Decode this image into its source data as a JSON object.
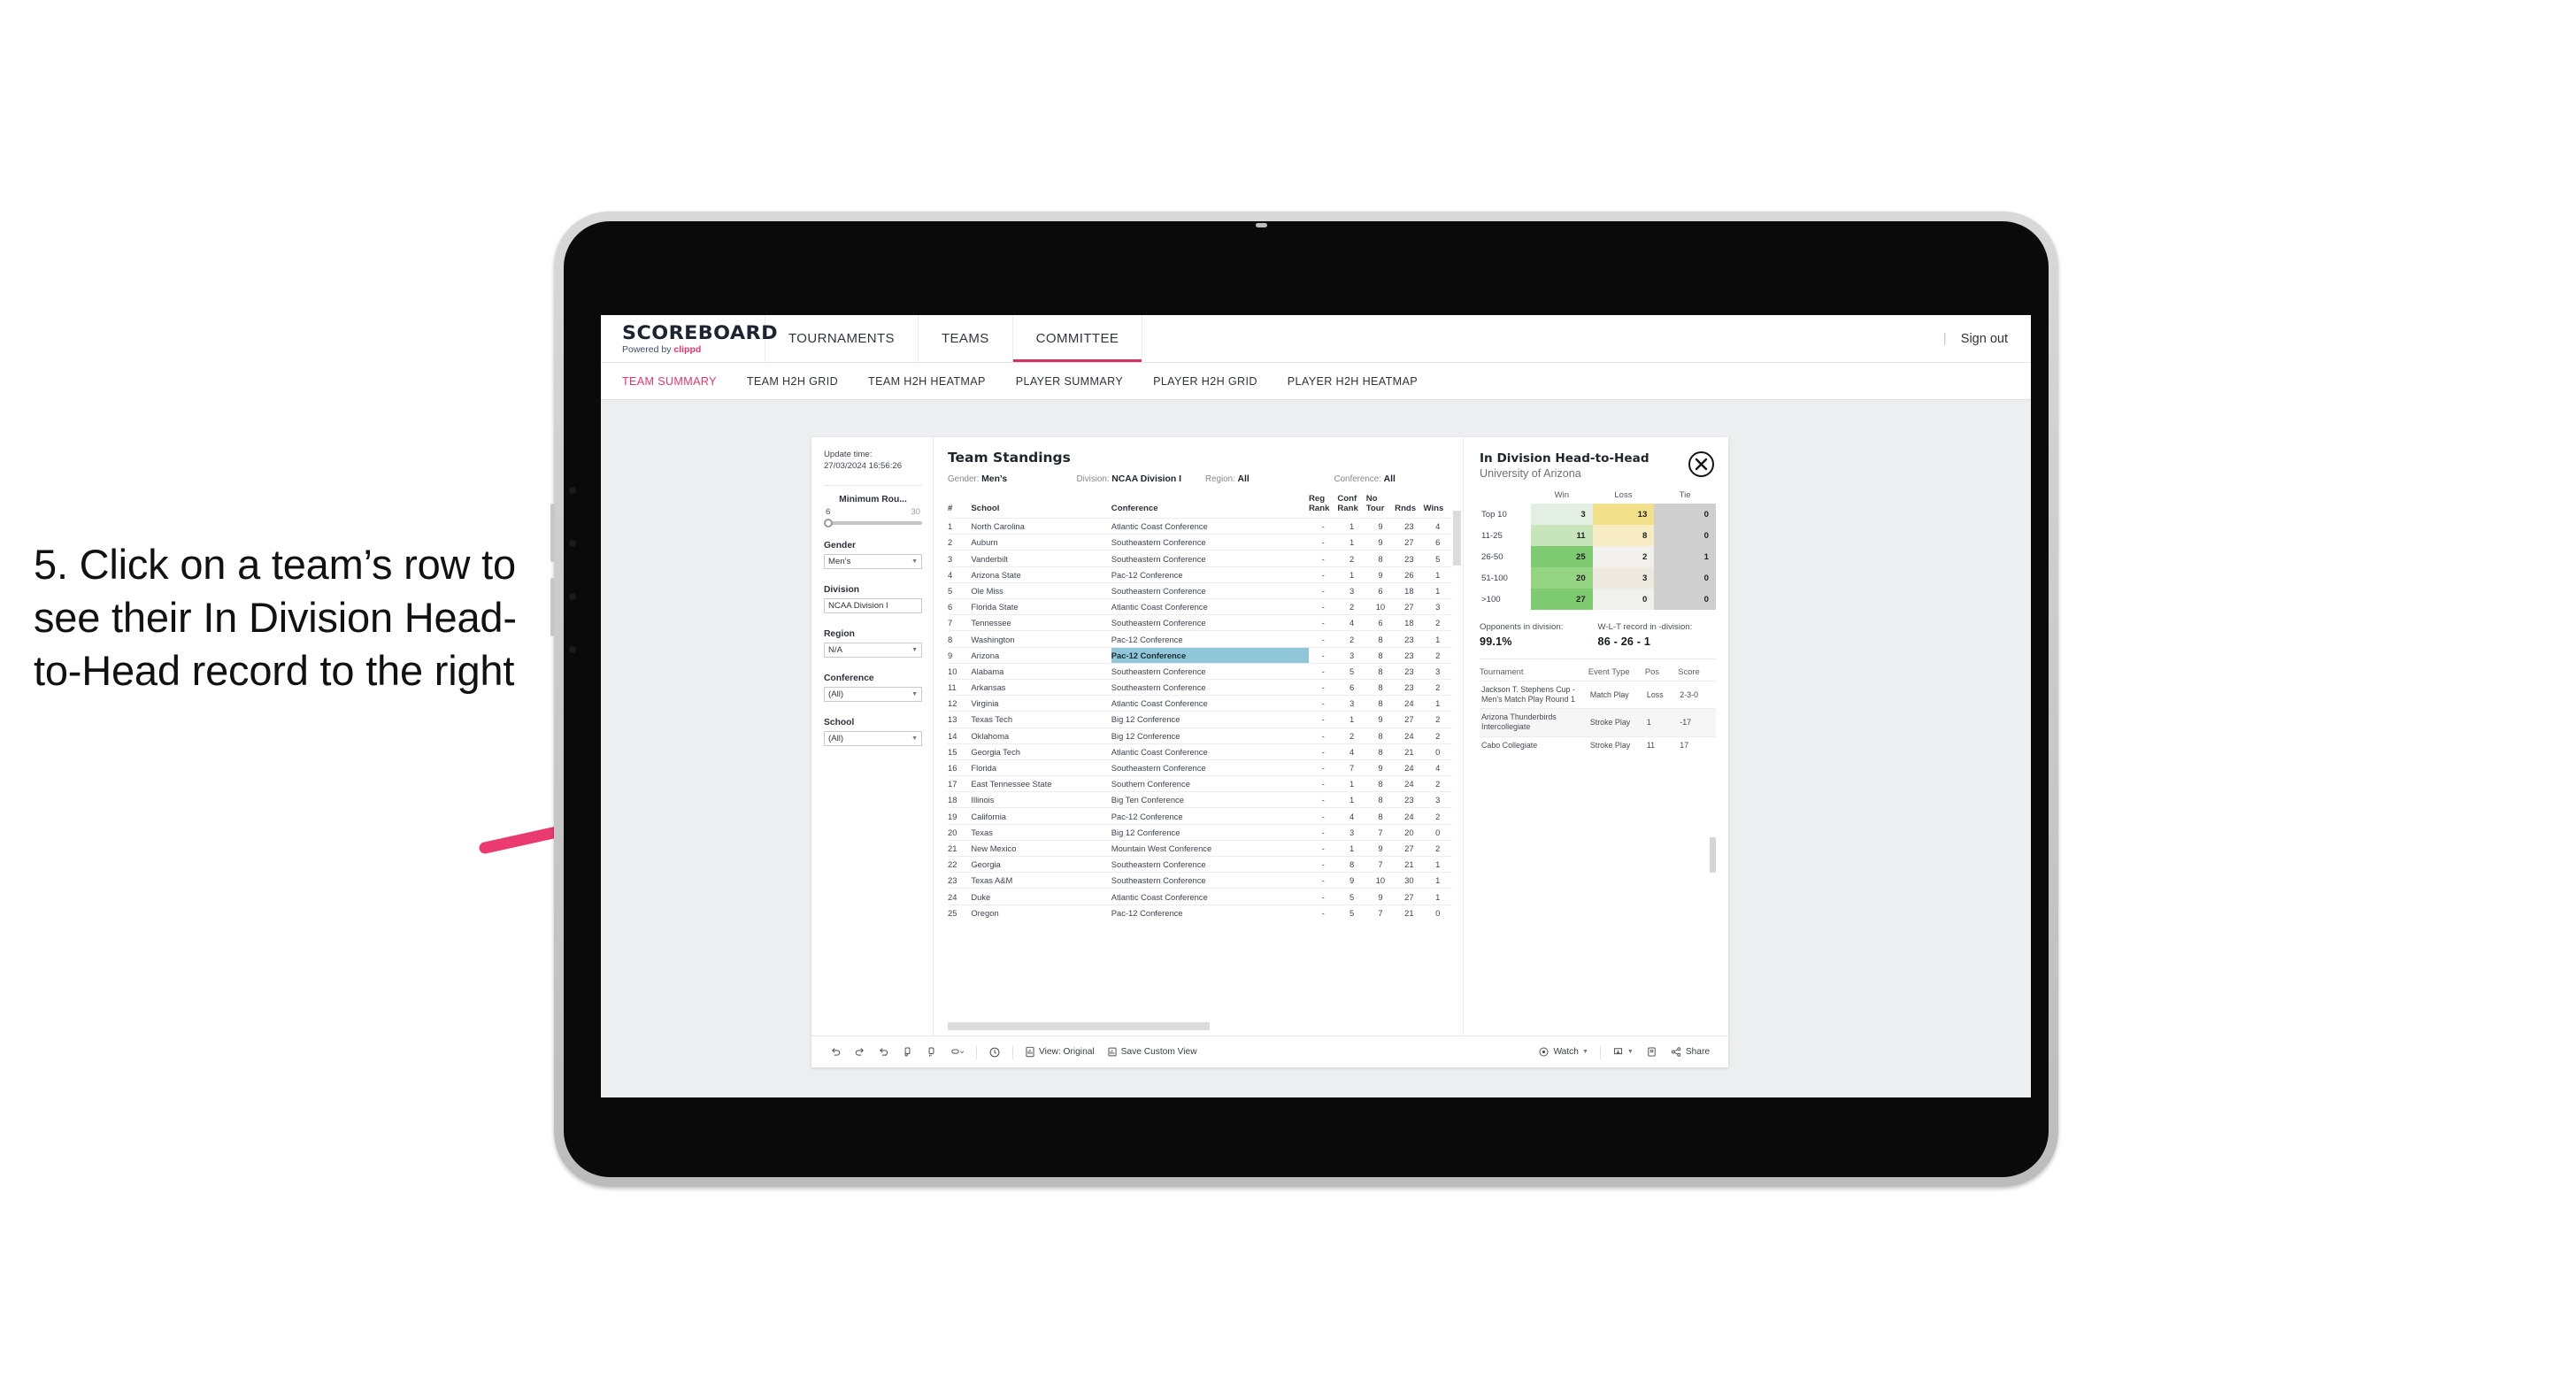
{
  "annotation": {
    "text": "5. Click on a team’s row to see their In Division Head-to-Head record to the right",
    "arrow_color": "#ea3a6f"
  },
  "app": {
    "logo": {
      "main": "SCOREBOARD",
      "powered_prefix": "Powered by ",
      "brand": "clippd"
    },
    "top_nav": [
      {
        "label": "TOURNAMENTS",
        "active": false
      },
      {
        "label": "TEAMS",
        "active": false
      },
      {
        "label": "COMMITTEE",
        "active": true
      }
    ],
    "sign_out": "Sign out",
    "divider": "|",
    "sub_tabs": [
      {
        "label": "TEAM SUMMARY",
        "active": true
      },
      {
        "label": "TEAM H2H GRID",
        "active": false
      },
      {
        "label": "TEAM H2H HEATMAP",
        "active": false
      },
      {
        "label": "PLAYER SUMMARY",
        "active": false
      },
      {
        "label": "PLAYER H2H GRID",
        "active": false
      },
      {
        "label": "PLAYER H2H HEATMAP",
        "active": false
      }
    ],
    "accent": "#e8356d"
  },
  "filters": {
    "update_time_label": "Update time:",
    "update_time_value": "27/03/2024 16:56:26",
    "slider": {
      "title": "Minimum Rou...",
      "min": "6",
      "max": "30"
    },
    "groups": [
      {
        "label": "Gender",
        "value": "Men’s"
      },
      {
        "label": "Division",
        "value": "NCAA Division I"
      },
      {
        "label": "Region",
        "value": "N/A"
      },
      {
        "label": "Conference",
        "value": "(All)"
      },
      {
        "label": "School",
        "value": "(All)"
      }
    ]
  },
  "standings": {
    "title": "Team Standings",
    "filter_summary": [
      {
        "label": "Gender:",
        "value": "Men’s"
      },
      {
        "label": "Division:",
        "value": "NCAA Division I"
      },
      {
        "label": "Region:",
        "value": "All"
      },
      {
        "label": "Conference:",
        "value": "All"
      }
    ],
    "columns": [
      "#",
      "School",
      "Conference",
      "Reg Rank",
      "Conf Rank",
      "No Tour",
      "Rnds",
      "Wins"
    ],
    "selected_row_index": 8,
    "highlight_color": "#8fc6d8",
    "rows": [
      {
        "rank": "1",
        "school": "North Carolina",
        "conference": "Atlantic Coast Conference",
        "reg_rank": "-",
        "conf_rank": "1",
        "no_tour": "9",
        "rnds": "23",
        "wins": "4"
      },
      {
        "rank": "2",
        "school": "Auburn",
        "conference": "Southeastern Conference",
        "reg_rank": "-",
        "conf_rank": "1",
        "no_tour": "9",
        "rnds": "27",
        "wins": "6"
      },
      {
        "rank": "3",
        "school": "Vanderbilt",
        "conference": "Southeastern Conference",
        "reg_rank": "-",
        "conf_rank": "2",
        "no_tour": "8",
        "rnds": "23",
        "wins": "5"
      },
      {
        "rank": "4",
        "school": "Arizona State",
        "conference": "Pac-12 Conference",
        "reg_rank": "-",
        "conf_rank": "1",
        "no_tour": "9",
        "rnds": "26",
        "wins": "1"
      },
      {
        "rank": "5",
        "school": "Ole Miss",
        "conference": "Southeastern Conference",
        "reg_rank": "-",
        "conf_rank": "3",
        "no_tour": "6",
        "rnds": "18",
        "wins": "1"
      },
      {
        "rank": "6",
        "school": "Florida State",
        "conference": "Atlantic Coast Conference",
        "reg_rank": "-",
        "conf_rank": "2",
        "no_tour": "10",
        "rnds": "27",
        "wins": "3"
      },
      {
        "rank": "7",
        "school": "Tennessee",
        "conference": "Southeastern Conference",
        "reg_rank": "-",
        "conf_rank": "4",
        "no_tour": "6",
        "rnds": "18",
        "wins": "2"
      },
      {
        "rank": "8",
        "school": "Washington",
        "conference": "Pac-12 Conference",
        "reg_rank": "-",
        "conf_rank": "2",
        "no_tour": "8",
        "rnds": "23",
        "wins": "1"
      },
      {
        "rank": "9",
        "school": "Arizona",
        "conference": "Pac-12 Conference",
        "reg_rank": "-",
        "conf_rank": "3",
        "no_tour": "8",
        "rnds": "23",
        "wins": "2"
      },
      {
        "rank": "10",
        "school": "Alabama",
        "conference": "Southeastern Conference",
        "reg_rank": "-",
        "conf_rank": "5",
        "no_tour": "8",
        "rnds": "23",
        "wins": "3"
      },
      {
        "rank": "11",
        "school": "Arkansas",
        "conference": "Southeastern Conference",
        "reg_rank": "-",
        "conf_rank": "6",
        "no_tour": "8",
        "rnds": "23",
        "wins": "2"
      },
      {
        "rank": "12",
        "school": "Virginia",
        "conference": "Atlantic Coast Conference",
        "reg_rank": "-",
        "conf_rank": "3",
        "no_tour": "8",
        "rnds": "24",
        "wins": "1"
      },
      {
        "rank": "13",
        "school": "Texas Tech",
        "conference": "Big 12 Conference",
        "reg_rank": "-",
        "conf_rank": "1",
        "no_tour": "9",
        "rnds": "27",
        "wins": "2"
      },
      {
        "rank": "14",
        "school": "Oklahoma",
        "conference": "Big 12 Conference",
        "reg_rank": "-",
        "conf_rank": "2",
        "no_tour": "8",
        "rnds": "24",
        "wins": "2"
      },
      {
        "rank": "15",
        "school": "Georgia Tech",
        "conference": "Atlantic Coast Conference",
        "reg_rank": "-",
        "conf_rank": "4",
        "no_tour": "8",
        "rnds": "21",
        "wins": "0"
      },
      {
        "rank": "16",
        "school": "Florida",
        "conference": "Southeastern Conference",
        "reg_rank": "-",
        "conf_rank": "7",
        "no_tour": "9",
        "rnds": "24",
        "wins": "4"
      },
      {
        "rank": "17",
        "school": "East Tennessee State",
        "conference": "Southern Conference",
        "reg_rank": "-",
        "conf_rank": "1",
        "no_tour": "8",
        "rnds": "24",
        "wins": "2"
      },
      {
        "rank": "18",
        "school": "Illinois",
        "conference": "Big Ten Conference",
        "reg_rank": "-",
        "conf_rank": "1",
        "no_tour": "8",
        "rnds": "23",
        "wins": "3"
      },
      {
        "rank": "19",
        "school": "California",
        "conference": "Pac-12 Conference",
        "reg_rank": "-",
        "conf_rank": "4",
        "no_tour": "8",
        "rnds": "24",
        "wins": "2"
      },
      {
        "rank": "20",
        "school": "Texas",
        "conference": "Big 12 Conference",
        "reg_rank": "-",
        "conf_rank": "3",
        "no_tour": "7",
        "rnds": "20",
        "wins": "0"
      },
      {
        "rank": "21",
        "school": "New Mexico",
        "conference": "Mountain West Conference",
        "reg_rank": "-",
        "conf_rank": "1",
        "no_tour": "9",
        "rnds": "27",
        "wins": "2"
      },
      {
        "rank": "22",
        "school": "Georgia",
        "conference": "Southeastern Conference",
        "reg_rank": "-",
        "conf_rank": "8",
        "no_tour": "7",
        "rnds": "21",
        "wins": "1"
      },
      {
        "rank": "23",
        "school": "Texas A&M",
        "conference": "Southeastern Conference",
        "reg_rank": "-",
        "conf_rank": "9",
        "no_tour": "10",
        "rnds": "30",
        "wins": "1"
      },
      {
        "rank": "24",
        "school": "Duke",
        "conference": "Atlantic Coast Conference",
        "reg_rank": "-",
        "conf_rank": "5",
        "no_tour": "9",
        "rnds": "27",
        "wins": "1"
      },
      {
        "rank": "25",
        "school": "Oregon",
        "conference": "Pac-12 Conference",
        "reg_rank": "-",
        "conf_rank": "5",
        "no_tour": "7",
        "rnds": "21",
        "wins": "0"
      }
    ]
  },
  "h2h": {
    "title": "In Division Head-to-Head",
    "subtitle": "University of Arizona",
    "close_icon": "close-circle-icon",
    "stats": [
      {
        "caption": "Opponents in division:",
        "value": "99.1%"
      },
      {
        "caption": "W-L-T record in -division:",
        "value": "86 - 26 - 1"
      }
    ],
    "tournament_columns": [
      "Tournament",
      "Event Type",
      "Pos",
      "Score"
    ],
    "tournaments": [
      {
        "name": "Jackson T. Stephens Cup - Men’s Match Play Round 1",
        "event_type": "Match Play",
        "pos": "Loss",
        "score": "2-3-0"
      },
      {
        "name": "Arizona Thunderbirds Intercollegiate",
        "event_type": "Stroke Play",
        "pos": "1",
        "score": "-17"
      },
      {
        "name": "Cabo Collegiate",
        "event_type": "Stroke Play",
        "pos": "11",
        "score": "17"
      }
    ],
    "chart_data": {
      "type": "heatmap",
      "title": "In Division Head-to-Head",
      "subtitle": "University of Arizona",
      "xlabel": "",
      "ylabel": "",
      "columns": [
        "Win",
        "Loss",
        "Tie"
      ],
      "rows": [
        "Top 10",
        "11-25",
        "26-50",
        "51-100",
        ">100"
      ],
      "values": [
        [
          3,
          13,
          0
        ],
        [
          11,
          8,
          0
        ],
        [
          25,
          2,
          1
        ],
        [
          20,
          3,
          0
        ],
        [
          27,
          0,
          0
        ]
      ],
      "cell_colors": [
        [
          "#e3efe2",
          "#f2e08a",
          "#cfcfcf"
        ],
        [
          "#c7e4bb",
          "#f7ecc4",
          "#cfcfcf"
        ],
        [
          "#7fcb72",
          "#f1f0ec",
          "#cfcfcf"
        ],
        [
          "#95d483",
          "#ede9df",
          "#cfcfcf"
        ],
        [
          "#7fcb72",
          "#f0f0ee",
          "#cfcfcf"
        ]
      ],
      "legend": "none",
      "grid": false
    }
  },
  "toolbar": {
    "items": [
      {
        "name": "undo-icon",
        "label": ""
      },
      {
        "name": "redo-icon",
        "label": ""
      },
      {
        "name": "revert-icon",
        "label": ""
      },
      {
        "name": "refresh-data-icon",
        "label": ""
      },
      {
        "name": "pause-updates-icon",
        "label": ""
      },
      {
        "name": "highlight-icon",
        "label": ""
      },
      {
        "name": "clock-icon",
        "label": ""
      },
      {
        "name": "view-original-icon",
        "label": "View: Original"
      },
      {
        "name": "save-custom-view-icon",
        "label": "Save Custom View"
      },
      {
        "name": "watch-icon",
        "label": "Watch"
      },
      {
        "name": "download-icon",
        "label": ""
      },
      {
        "name": "fullscreen-icon",
        "label": ""
      },
      {
        "name": "share-icon",
        "label": "Share"
      }
    ]
  }
}
